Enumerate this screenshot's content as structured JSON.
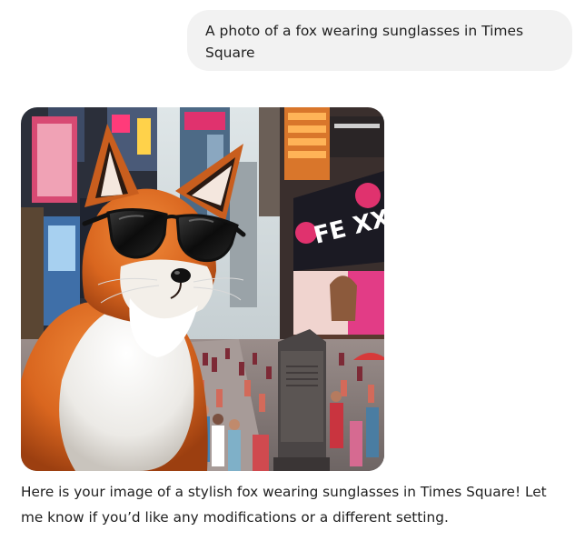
{
  "conversation": {
    "user_message": "A photo of a fox wearing sunglasses in Times Square",
    "assistant_message": "Here is your image of a stylish fox wearing sunglasses in Times Square! Let me know if you’d like any modifications or a different setting."
  },
  "image": {
    "billboard_text": "FE XX"
  },
  "colors": {
    "user_bubble": "#f2f2f2",
    "text": "#1f1f1f",
    "fox_orange": "#d9661f",
    "neon_pink": "#e0326e"
  }
}
